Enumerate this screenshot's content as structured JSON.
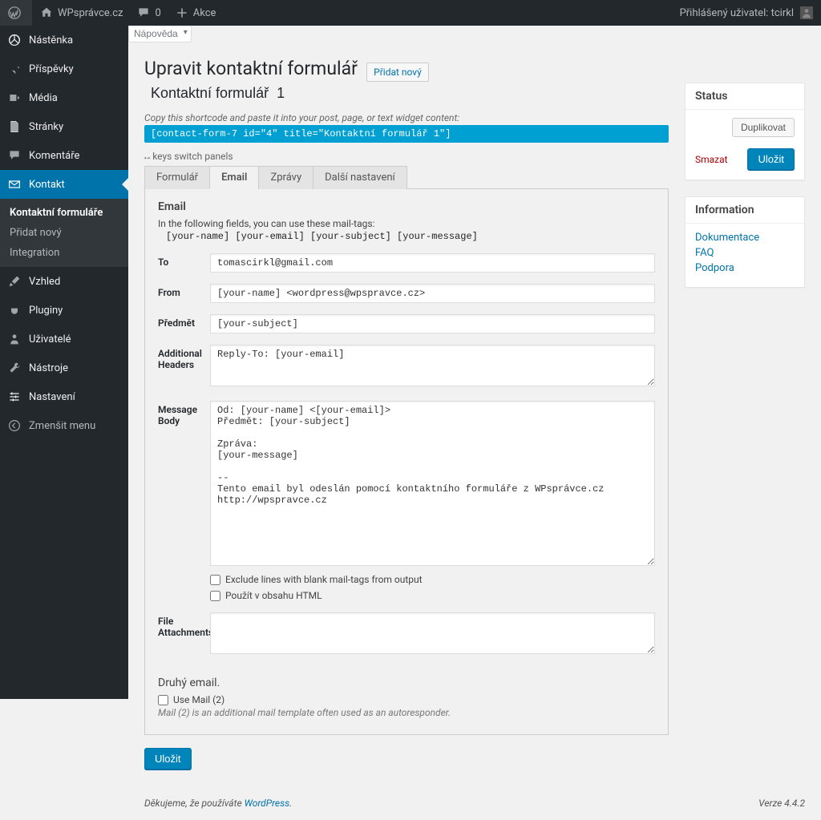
{
  "adminbar": {
    "site_name": "WPsprávce.cz",
    "comments_count": "0",
    "new_label": "Akce",
    "logged_in_prefix": "Přihlášený uživatel: ",
    "username": "tcirkl"
  },
  "screen_options": {
    "help": "Nápověda"
  },
  "sidebar": {
    "items": [
      {
        "id": "dashboard",
        "label": "Nástěnka",
        "icon": "dashboard"
      },
      {
        "id": "posts",
        "label": "Příspěvky",
        "icon": "pin"
      },
      {
        "id": "media",
        "label": "Média",
        "icon": "media"
      },
      {
        "id": "pages",
        "label": "Stránky",
        "icon": "page"
      },
      {
        "id": "comments",
        "label": "Komentáře",
        "icon": "comment"
      },
      {
        "id": "contact",
        "label": "Kontakt",
        "icon": "mail",
        "current": true
      },
      {
        "id": "appearance",
        "label": "Vzhled",
        "icon": "brush"
      },
      {
        "id": "plugins",
        "label": "Pluginy",
        "icon": "plug"
      },
      {
        "id": "users",
        "label": "Uživatelé",
        "icon": "user"
      },
      {
        "id": "tools",
        "label": "Nástroje",
        "icon": "wrench"
      },
      {
        "id": "settings",
        "label": "Nastavení",
        "icon": "sliders"
      }
    ],
    "submenu": [
      {
        "label": "Kontaktní formuláře",
        "current": true
      },
      {
        "label": "Přidat nový"
      },
      {
        "label": "Integration"
      }
    ],
    "collapse": "Zmenšit menu"
  },
  "page": {
    "title": "Upravit kontaktní formulář",
    "add_new": "Přidat nový",
    "form_title": "Kontaktní formulář  1",
    "shortcode_hint": "Copy this shortcode and paste it into your post, page, or text widget content:",
    "shortcode": "[contact-form-7 id=\"4\" title=\"Kontaktní formulář  1\"]",
    "panel_switch": "keys switch panels",
    "tabs": [
      "Formulář",
      "Email",
      "Zprávy",
      "Další nastavení"
    ],
    "active_tab": 1
  },
  "email_panel": {
    "heading": "Email",
    "hint": "In the following fields, you can use these mail-tags:",
    "tags": "[your-name] [your-email] [your-subject] [your-message]",
    "to_label": "To",
    "to_value": "tomascirkl@gmail.com",
    "from_label": "From",
    "from_value": "[your-name] <wordpress@wpspravce.cz>",
    "subject_label": "Předmět",
    "subject_value": "[your-subject]",
    "headers_label": "Additional Headers",
    "headers_value": "Reply-To: [your-email]",
    "body_label": "Message Body",
    "body_value": "Od: [your-name] <[your-email]>\nPředmět: [your-subject]\n\nZpráva:\n[your-message]\n\n--\nTento email byl odeslán pomocí kontaktního formuláře z WPsprávce.cz http://wpspravce.cz",
    "cb_exclude": "Exclude lines with blank mail-tags from output",
    "cb_html": "Použít v obsahu HTML",
    "attachments_label": "File Attachments",
    "attachments_value": "",
    "mail2_heading": "Druhý email.",
    "mail2_cb": "Use Mail (2)",
    "mail2_hint": "Mail (2) is an additional mail template often used as an autoresponder."
  },
  "side": {
    "status_title": "Status",
    "duplicate": "Duplikovat",
    "delete": "Smazat",
    "save": "Uložit",
    "info_title": "Information",
    "info_links": [
      {
        "label": "Dokumentace"
      },
      {
        "label": "FAQ"
      },
      {
        "label": "Podpora"
      }
    ]
  },
  "footer": {
    "thanks_prefix": "Děkujeme, že používáte ",
    "wp": "WordPress",
    "version": "Verze 4.4.2"
  },
  "save_button": "Uložit"
}
